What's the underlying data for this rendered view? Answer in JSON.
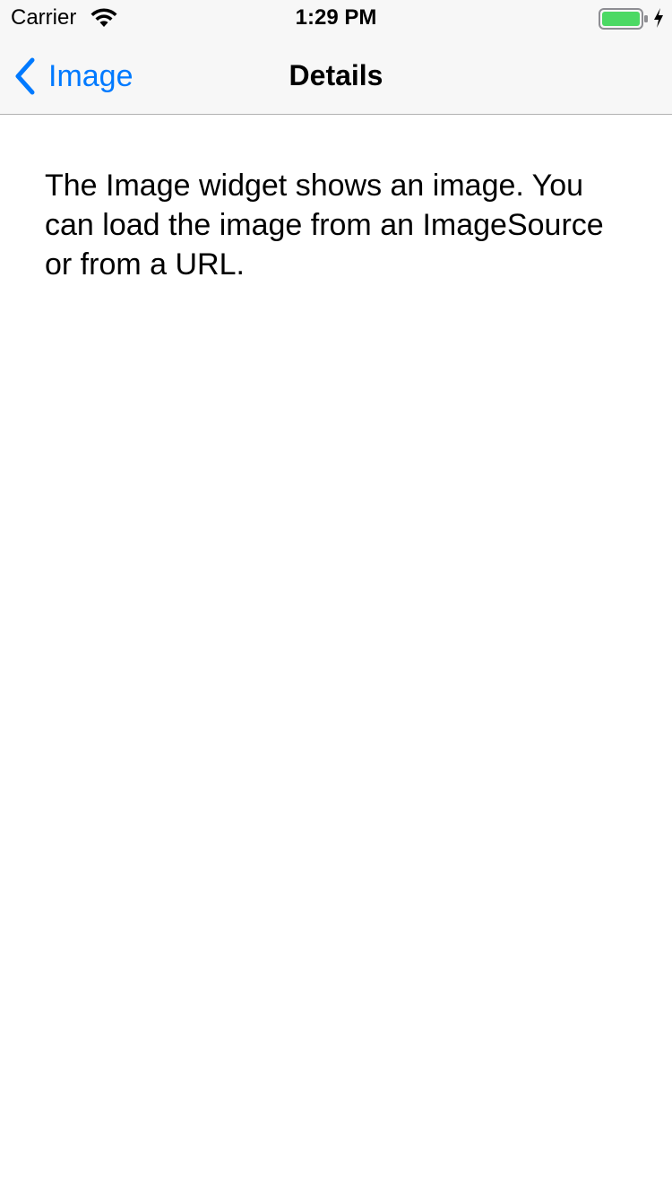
{
  "status_bar": {
    "carrier": "Carrier",
    "time": "1:29 PM",
    "wifi_icon": "wifi-icon",
    "battery_icon": "battery-icon",
    "charging_icon": "charging-bolt-icon",
    "battery_level": 1.0,
    "battery_color": "#4cd964"
  },
  "nav_bar": {
    "back_label": "Image",
    "back_icon": "chevron-left-icon",
    "title": "Details",
    "accent_color": "#007aff"
  },
  "content": {
    "description": "The Image widget shows an image. You can load the image from an ImageSource or from a URL."
  }
}
